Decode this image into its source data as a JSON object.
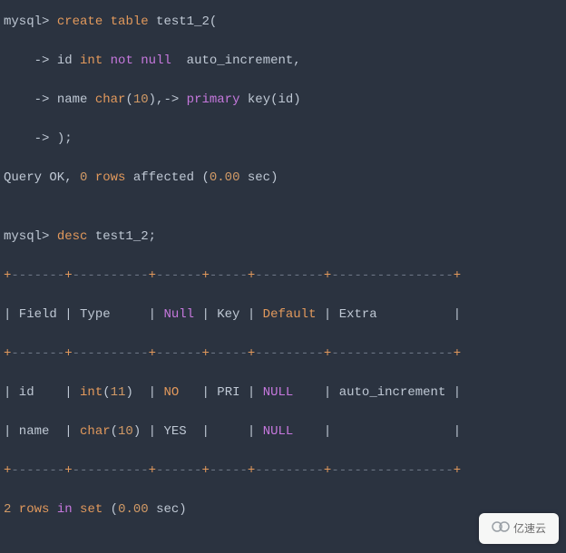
{
  "lines": {
    "l1_prompt": "mysql> ",
    "l1_kw1": "create",
    "l1_kw2": "table",
    "l1_rest": " test1_2(",
    "l2_cont": "    -> ",
    "l2_id": "id ",
    "l2_int": "int",
    "l2_not": " not",
    "l2_null": " null",
    "l2_rest": "  auto_increment,",
    "l3_cont": "    -> ",
    "l3_name": "name ",
    "l3_char": "char",
    "l3_open": "(",
    "l3_num": "10",
    "l3_close": "),-> ",
    "l3_primary": "primary",
    "l3_key": " key(id)",
    "l4_cont": "    -> ",
    "l4_rest": ");",
    "l5_a": "Query OK, ",
    "l5_zero": "0",
    "l5_rows": " rows",
    "l5_b": " affected (",
    "l5_time": "0.00",
    "l5_c": " sec)",
    "l6_prompt": "mysql> ",
    "l6_desc": "desc",
    "l6_rest": " test1_2;",
    "sep_plus": "+",
    "sep_body_1": "-------",
    "sep_body_2": "----------",
    "sep_body_3": "------",
    "sep_body_4": "-----",
    "sep_body_5": "---------",
    "sep_body_6": "----------------",
    "hdr": "| Field | Type     | ",
    "hdr_null": "Null",
    "hdr_b": " | Key | ",
    "hdr_default": "Default",
    "hdr_c": " | Extra          |",
    "r1_a": "| id    | ",
    "r1_int": "int",
    "r1_paren_o": "(",
    "r1_num": "11",
    "r1_paren_c": ")",
    "r1_sp": "  | ",
    "r1_no": "NO",
    "r1_b": "   | PRI | ",
    "r1_null": "NULL",
    "r1_c": "    | auto_increment |",
    "r2_a": "| name  | ",
    "r2_char": "char",
    "r2_paren_o": "(",
    "r2_num": "10",
    "r2_paren_c": ")",
    "r2_sp": " | ",
    "r2_yes": "YES",
    "r2_b": "  |     | ",
    "r2_null": "NULL",
    "r2_c": "    |                |",
    "ft_a": "2",
    "ft_rows": " rows ",
    "ft_in": "in",
    "ft_set": " set",
    "ft_b": " (",
    "ft_time": "0.00",
    "ft_c": " sec)"
  },
  "badge_text": "亿速云"
}
